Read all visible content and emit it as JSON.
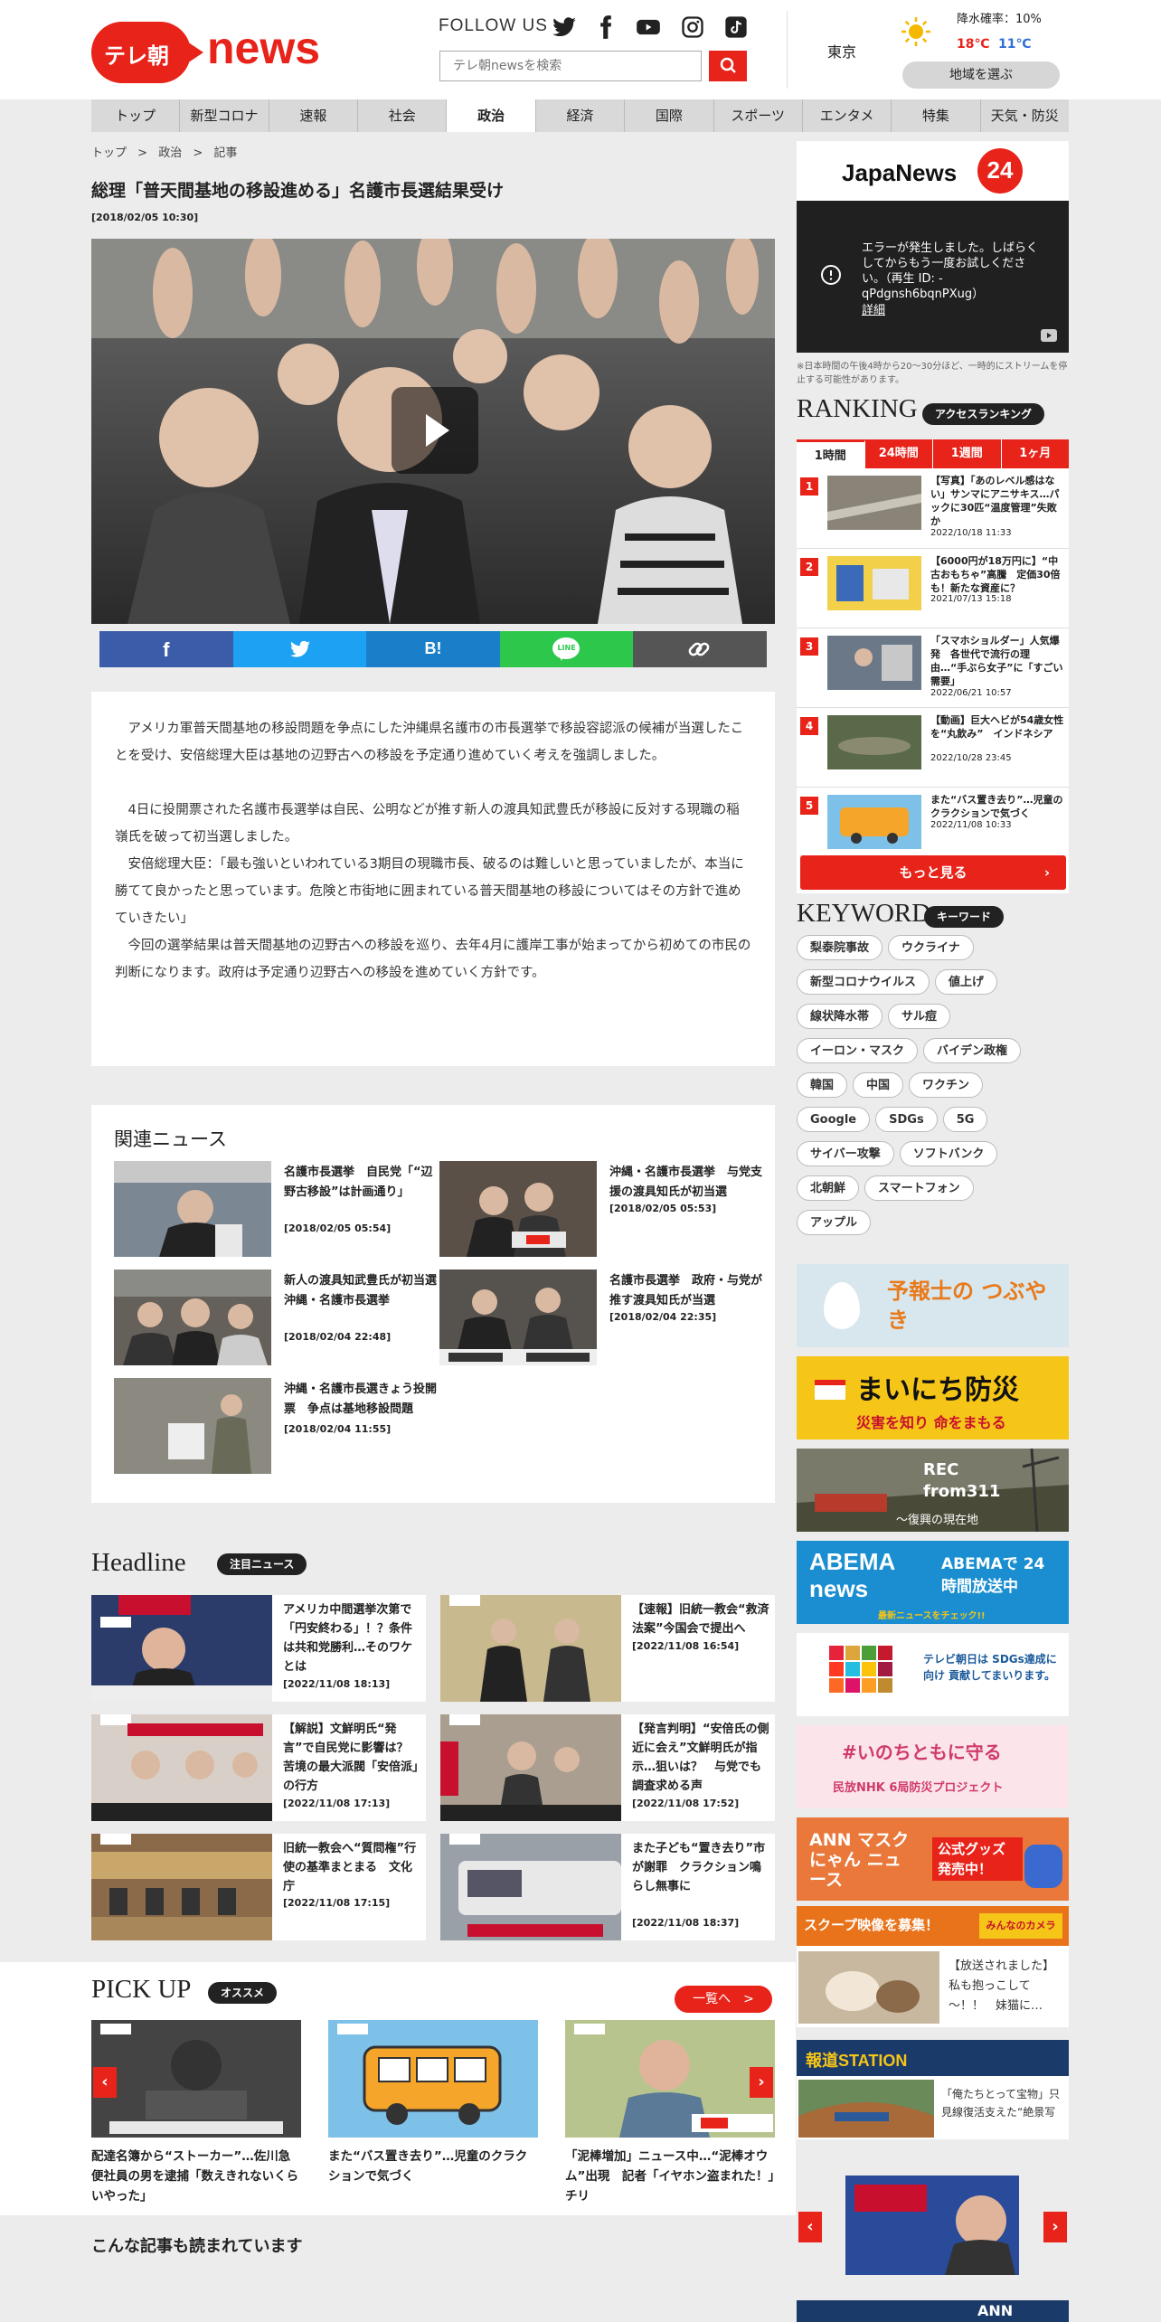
{
  "header": {
    "logo_jp": "テレ朝",
    "logo_news": "news",
    "follow": "FOLLOW US",
    "search_placeholder": "テレ朝newsを検索",
    "city": "東京",
    "rain": "降水確率：10%",
    "temp_high": "18℃",
    "temp_low": "11℃",
    "region_button": "地域を選ぶ"
  },
  "nav": [
    "トップ",
    "新型コロナ",
    "速報",
    "社会",
    "政治",
    "経済",
    "国際",
    "スポーツ",
    "エンタメ",
    "特集",
    "天気・防災"
  ],
  "breadcrumb": {
    "top": "トップ",
    "politics": "政治",
    "article": "記事",
    "sep": ">"
  },
  "article": {
    "title": "総理「普天間基地の移設進める」名護市長選結果受け",
    "date": "[2018/02/05 10:30]",
    "p1": "　アメリカ軍普天間基地の移設問題を争点にした沖縄県名護市の市長選挙で移設容認派の候補が当選したことを受け、安倍総理大臣は基地の辺野古への移設を予定通り進めていく考えを強調しました。",
    "p2": "　4日に投開票された名護市長選挙は自民、公明などが推す新人の渡具知武豊氏が移設に反対する現職の稲嶺氏を破って初当選しました。",
    "p3": "　安倍総理大臣：「最も強いといわれている3期目の現職市長、破るのは難しいと思っていましたが、本当に勝てて良かったと思っています。危険と市街地に囲まれている普天間基地の移設についてはその方針で進めていきたい」",
    "p4": "　今回の選挙結果は普天間基地の辺野古への移設を巡り、去年4月に護岸工事が始まってから初めての市民の判断になります。政府は予定通り辺野古への移設を進めていく方針です。"
  },
  "share": {
    "facebook": "f",
    "twitter": "twitter",
    "hatena": "B!",
    "line": "LINE",
    "link": "link"
  },
  "related": {
    "heading": "関連ニュース",
    "items": [
      {
        "title": "名護市長選挙　自民党「“辺野古移設”は計画通り」",
        "date": "[2018/02/05 05:54]"
      },
      {
        "title": "沖縄・名護市長選挙　与党支援の渡具知氏が初当選",
        "date": "[2018/02/05 05:53]"
      },
      {
        "title": "新人の渡具知武豊氏が初当選　沖縄・名護市長選挙",
        "date": "[2018/02/04 22:48]"
      },
      {
        "title": "名護市長選挙　政府・与党が推す渡具知氏が当選",
        "date": "[2018/02/04 22:35]"
      },
      {
        "title": "沖縄・名護市長選きょう投開票　争点は基地移設問題",
        "date": "[2018/02/04 11:55]"
      }
    ]
  },
  "headline": {
    "heading": "Headline",
    "badge": "注目ニュース",
    "items": [
      {
        "title": "アメリカ中間選挙次第で「円安終わる」！？条件は共和党勝利…そのワケとは",
        "date": "[2022/11/08 18:13]"
      },
      {
        "title": "【速報】旧統一教会“救済法案”今国会で提出へ",
        "date": "[2022/11/08 16:54]"
      },
      {
        "title": "【解説】文鮮明氏“発言”で自民党に影響は？　苦境の最大派閥「安倍派」の行方",
        "date": "[2022/11/08 17:13]"
      },
      {
        "title": "【発言判明】“安倍氏の側近に会え”文鮮明氏が指示…狙いは？　与党でも調査求める声",
        "date": "[2022/11/08 17:52]"
      },
      {
        "title": "旧統一教会へ“質問権”行使の基準まとまる　文化庁",
        "date": "[2022/11/08 17:15]"
      },
      {
        "title": "また子ども“置き去り”市が謝罪　クラクション鳴らし無事に",
        "date": "[2022/11/08 18:37]"
      }
    ]
  },
  "pickup": {
    "heading": "PICK UP",
    "badge": "オススメ",
    "more": "一覧へ　>",
    "items": [
      {
        "title": "配達名簿から“ストーカー”…佐川急便社員の男を逮捕「数えきれないくらいやった」"
      },
      {
        "title": "また“バス置き去り”…児童のクラクションで気づく"
      },
      {
        "title": "「泥棒増加」ニュース中…“泥棒オウム”出現　記者「イヤホン盗まれた！」　チリ"
      }
    ]
  },
  "also": "こんな記事も読まれています",
  "sidebar": {
    "japanews": "JapaNews",
    "jn24": "24",
    "error": "エラーが発生しました。しばらくしてからもう一度お試しください。（再生 ID: -qPdgnsh6bqnPXug）",
    "error_link": "詳細",
    "note": "※日本時間の午後4時から20～30分ほど、一時的にストリームを停止する可能性があります。",
    "ranking": {
      "heading": "RANKING",
      "badge": "アクセスランキング",
      "tabs": [
        "1時間",
        "24時間",
        "1週間",
        "1ヶ月"
      ],
      "more": "もっと見る",
      "items": [
        {
          "n": "1",
          "title": "【写真】「あのレベル感はない」サンマにアニサキス…パックに30匹“温度管理”失敗か",
          "date": "2022/10/18 11:33"
        },
        {
          "n": "2",
          "title": "【6000円が18万円に】“中古おもちゃ”高騰　定価30倍も！新たな資産に？",
          "date": "2021/07/13 15:18"
        },
        {
          "n": "3",
          "title": "「スマホショルダー」人気爆発　各世代で流行の理由…“手ぶら女子”に「すごい需要」",
          "date": "2022/06/21 10:57"
        },
        {
          "n": "4",
          "title": "【動画】巨大ヘビが54歳女性を“丸飲み”　インドネシア",
          "date": "2022/10/28 23:45"
        },
        {
          "n": "5",
          "title": "また“バス置き去り”…児童のクラクションで気づく",
          "date": "2022/11/08 10:33"
        }
      ]
    },
    "keyword": {
      "heading": "KEYWORD",
      "badge": "キーワード",
      "items": [
        "梨泰院事故",
        "ウクライナ",
        "新型コロナウイルス",
        "値上げ",
        "線状降水帯",
        "サル痘",
        "イーロン・マスク",
        "バイデン政権",
        "韓国",
        "中国",
        "ワクチン",
        "Google",
        "SDGs",
        "5G",
        "サイバー攻撃",
        "ソフトバンク",
        "北朝鮮",
        "スマートフォン",
        "アップル"
      ]
    },
    "banners": {
      "yohoushi": "予報士の つぶやき",
      "bousai": "まいにち防災",
      "bousai_sub": "災害を知り 命をまもる",
      "rec": "REC from311",
      "rec_sub": "～復興の現在地",
      "abema": "ABEMA news",
      "abema_sub": "ABEMAで 24時間放送中",
      "abema_tag": "最新ニュースをチェック!!",
      "sdgs": "テレビ朝日は SDGs達成に向け 貢献してまいります。",
      "nhk": "#いのちともに守る",
      "nhk_sub": "民放NHK 6局防災プロジェクト",
      "mask": "ANN マスクにゃん ニュース",
      "mask_goods": "公式グッズ 発売中！",
      "scoop": "スクープ映像を募集！",
      "scoop_brand": "みんなのカメラ",
      "scoop_text": "【放送されました】私も抱っこして～！！　妹猫に…",
      "hodo": "報道STATION",
      "hodo_text": "「俺たちとって宝物」只見線復活支えた“絶景写",
      "bottom": "ANN"
    }
  },
  "colors": {
    "brand": "#e8231a",
    "facebook": "#3b5ca8",
    "twitter": "#1da1f2",
    "hatena": "#1a7fc8",
    "line": "#2dc84b",
    "link": "#555555"
  }
}
